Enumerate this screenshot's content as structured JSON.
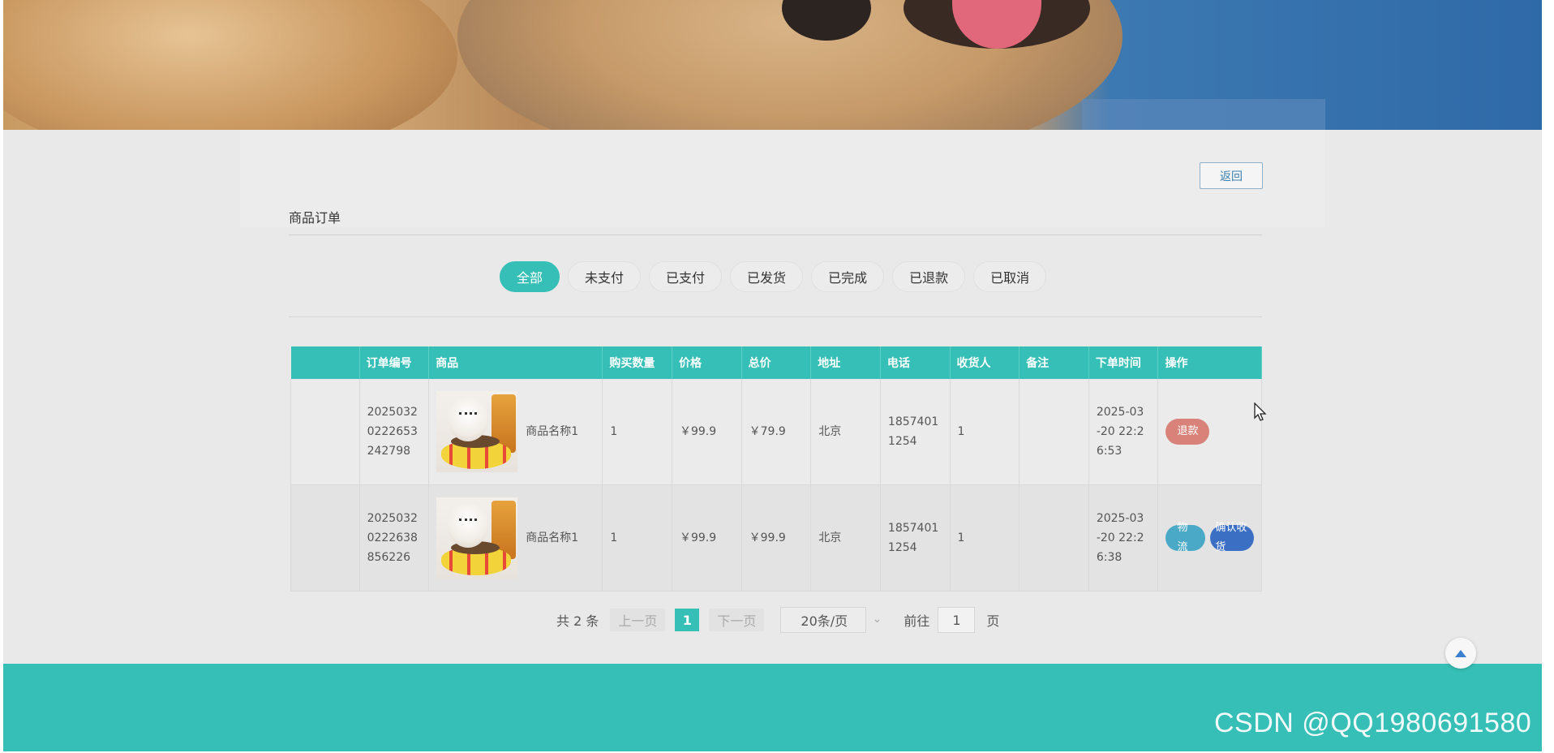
{
  "header": {
    "back_label": "返回",
    "section_title": "商品订单"
  },
  "tabs": [
    {
      "label": "全部",
      "active": true
    },
    {
      "label": "未支付",
      "active": false
    },
    {
      "label": "已支付",
      "active": false
    },
    {
      "label": "已发货",
      "active": false
    },
    {
      "label": "已完成",
      "active": false
    },
    {
      "label": "已退款",
      "active": false
    },
    {
      "label": "已取消",
      "active": false
    }
  ],
  "table": {
    "columns": [
      "",
      "订单编号",
      "商品",
      "购买数量",
      "价格",
      "总价",
      "地址",
      "电话",
      "收货人",
      "备注",
      "下单时间",
      "操作"
    ],
    "rows": [
      {
        "order_no": "20250320222653242798",
        "order_no_lines": [
          "2025032",
          "0222653",
          "242798"
        ],
        "goods_name": "商品名称1",
        "qty": "1",
        "price": "￥99.9",
        "total": "￥79.9",
        "address": "北京",
        "phone_lines": [
          "1857401",
          "1254"
        ],
        "receiver": "1",
        "note": "",
        "time_lines": [
          "2025-03",
          "-20 22:2",
          "6:53"
        ],
        "actions": [
          "退款"
        ]
      },
      {
        "order_no": "20250320222638856226",
        "order_no_lines": [
          "2025032",
          "0222638",
          "856226"
        ],
        "goods_name": "商品名称1",
        "qty": "1",
        "price": "￥99.9",
        "total": "￥99.9",
        "address": "北京",
        "phone_lines": [
          "1857401",
          "1254"
        ],
        "receiver": "1",
        "note": "",
        "time_lines": [
          "2025-03",
          "-20 22:2",
          "6:38"
        ],
        "actions": [
          "物流",
          "确认收货"
        ]
      }
    ]
  },
  "pagination": {
    "total_text": "共 2 条",
    "prev_label": "上一页",
    "current_page": "1",
    "next_label": "下一页",
    "page_size": "20条/页",
    "goto_label": "前往",
    "goto_value": "1",
    "page_suffix": "页"
  },
  "watermark": "CSDN @QQ1980691580",
  "colors": {
    "accent": "#36bfb6",
    "refund": "#d9827a",
    "logistics": "#4aa9c7",
    "confirm": "#3a6fc4"
  },
  "icons": {
    "back_to_top": "arrow-up-icon",
    "page_size_dropdown": "chevron-down-icon",
    "cursor": "mouse-pointer-icon"
  }
}
